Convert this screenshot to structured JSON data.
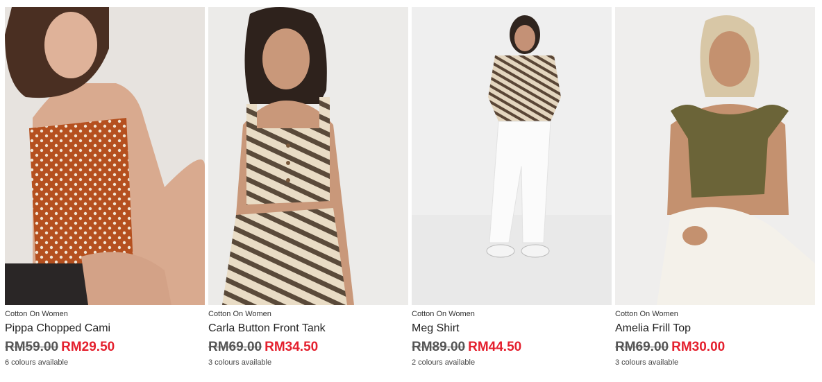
{
  "products": [
    {
      "brand": "Cotton On Women",
      "name": "Pippa Chopped Cami",
      "old_price": "RM59.00",
      "new_price": "RM29.50",
      "colours": "6 colours available"
    },
    {
      "brand": "Cotton On Women",
      "name": "Carla Button Front Tank",
      "old_price": "RM69.00",
      "new_price": "RM34.50",
      "colours": "3 colours available"
    },
    {
      "brand": "Cotton On Women",
      "name": "Meg Shirt",
      "old_price": "RM89.00",
      "new_price": "RM44.50",
      "colours": "2 colours available"
    },
    {
      "brand": "Cotton On Women",
      "name": "Amelia Frill Top",
      "old_price": "RM69.00",
      "new_price": "RM30.00",
      "colours": "3 colours available"
    }
  ],
  "colors": {
    "sale_price": "#e4202e",
    "old_price": "#555555"
  }
}
